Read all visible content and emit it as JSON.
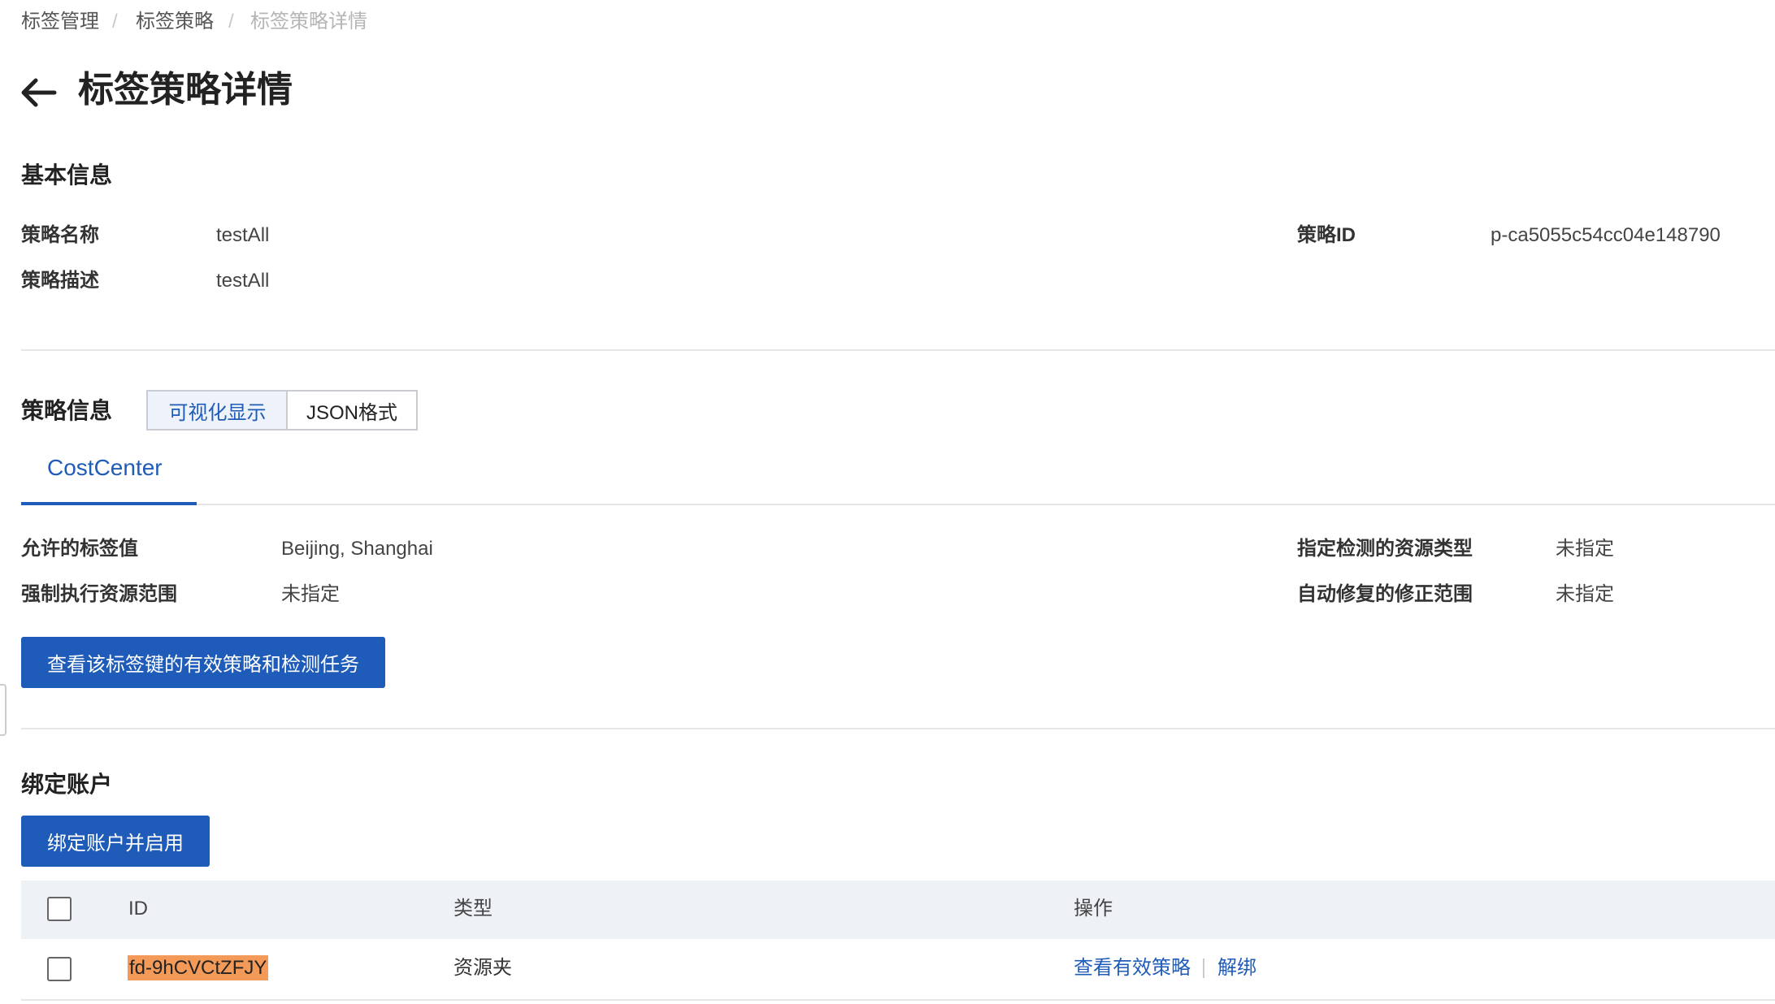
{
  "breadcrumb": [
    "标签管理",
    "标签策略",
    "标签策略详情"
  ],
  "breadcrumb_sep": "/",
  "page_title": "标签策略详情",
  "basic": {
    "title": "基本信息",
    "name_label": "策略名称",
    "name_value": "testAll",
    "desc_label": "策略描述",
    "desc_value": "testAll",
    "id_label": "策略ID",
    "id_value": "p-ca5055c54cc04e148790"
  },
  "policy": {
    "title": "策略信息",
    "view_tabs": [
      "可视化显示",
      "JSON格式"
    ],
    "active_view": 0,
    "tag_tab": "CostCenter",
    "allowed_label": "允许的标签值",
    "allowed_value": "Beijing, Shanghai",
    "enforce_label": "强制执行资源范围",
    "enforce_value": "未指定",
    "detect_label": "指定检测的资源类型",
    "detect_value": "未指定",
    "remediate_label": "自动修复的修正范围",
    "remediate_value": "未指定",
    "view_button": "查看该标签键的有效策略和检测任务"
  },
  "accounts": {
    "title": "绑定账户",
    "bind_button": "绑定账户并启用",
    "columns": [
      "ID",
      "类型",
      "操作"
    ],
    "rows": [
      {
        "id": "fd-9hCVCtZFJY",
        "type": "资源夹",
        "actions": [
          "查看有效策略",
          "解绑"
        ]
      }
    ]
  },
  "colors": {
    "primary": "#1f5bb8",
    "highlight": "#f39a58",
    "header_bg": "#eef1f6"
  }
}
